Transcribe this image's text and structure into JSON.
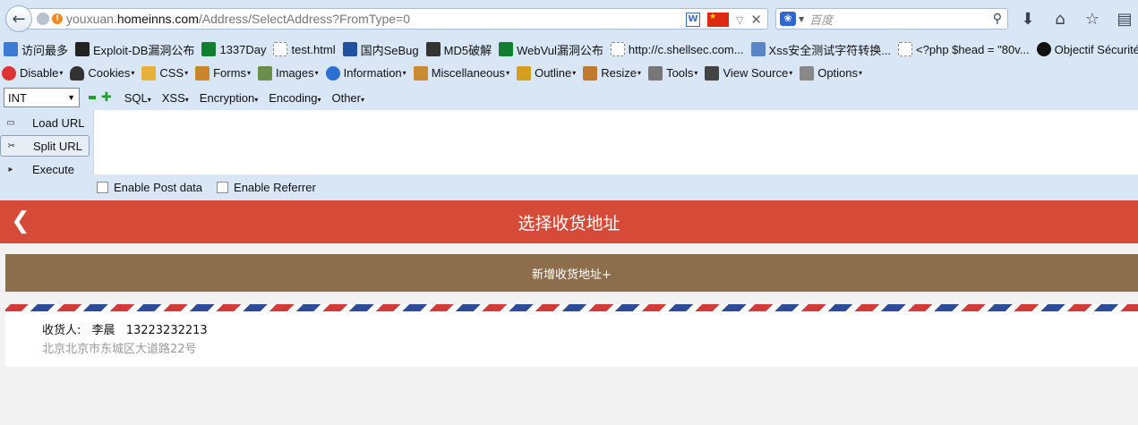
{
  "browser": {
    "url_prefix": "youxuan.",
    "url_domain": "homeinns.com",
    "url_path": "/Address/SelectAddress?FromType=0",
    "search_placeholder": "百度",
    "bookmarks": [
      {
        "label": "访问最多",
        "icon": "bookmark-icon"
      },
      {
        "label": "Exploit-DB漏洞公布",
        "icon": "exploitdb-icon"
      },
      {
        "label": "1337Day",
        "icon": "1337day-icon"
      },
      {
        "label": "test.html",
        "icon": "page-icon"
      },
      {
        "label": "国内SeBug",
        "icon": "sebug-icon"
      },
      {
        "label": "MD5破解",
        "icon": "md5-icon"
      },
      {
        "label": "WebVul漏洞公布",
        "icon": "webvul-icon"
      },
      {
        "label": "http://c.shellsec.com...",
        "icon": "page-icon"
      },
      {
        "label": "Xss安全测试字符转换...",
        "icon": "xss-icon"
      },
      {
        "label": "<?php $head = \"80v...",
        "icon": "page-icon"
      },
      {
        "label": "Objectif Sécurité - A...",
        "icon": "objectif-icon"
      }
    ],
    "webdev_toolbar": [
      {
        "label": "Disable",
        "icon": "disable-icon"
      },
      {
        "label": "Cookies",
        "icon": "cookies-icon"
      },
      {
        "label": "CSS",
        "icon": "css-icon"
      },
      {
        "label": "Forms",
        "icon": "forms-icon"
      },
      {
        "label": "Images",
        "icon": "images-icon"
      },
      {
        "label": "Information",
        "icon": "information-icon"
      },
      {
        "label": "Miscellaneous",
        "icon": "miscellaneous-icon"
      },
      {
        "label": "Outline",
        "icon": "outline-icon"
      },
      {
        "label": "Resize",
        "icon": "resize-icon"
      },
      {
        "label": "Tools",
        "icon": "tools-icon"
      },
      {
        "label": "View Source",
        "icon": "view-source-icon"
      },
      {
        "label": "Options",
        "icon": "options-icon"
      }
    ]
  },
  "hackbar": {
    "select_value": "INT",
    "menus": [
      "SQL",
      "XSS",
      "Encryption",
      "Encoding",
      "Other"
    ],
    "actions": [
      "Load URL",
      "Split URL",
      "Execute"
    ],
    "textarea_value": "",
    "checkboxes": [
      "Enable Post data",
      "Enable Referrer"
    ]
  },
  "page": {
    "header_title": "选择收货地址",
    "add_button": "新增收货地址+",
    "address": {
      "label": "收货人:",
      "name": "李晨",
      "phone": "13223232213",
      "detail": "北京北京市东城区大道路22号"
    }
  },
  "colors": {
    "header": "#d64a38",
    "add_button": "#8c6e4c",
    "stripe_red": "#d33a3a",
    "stripe_blue": "#2e4b9a"
  }
}
